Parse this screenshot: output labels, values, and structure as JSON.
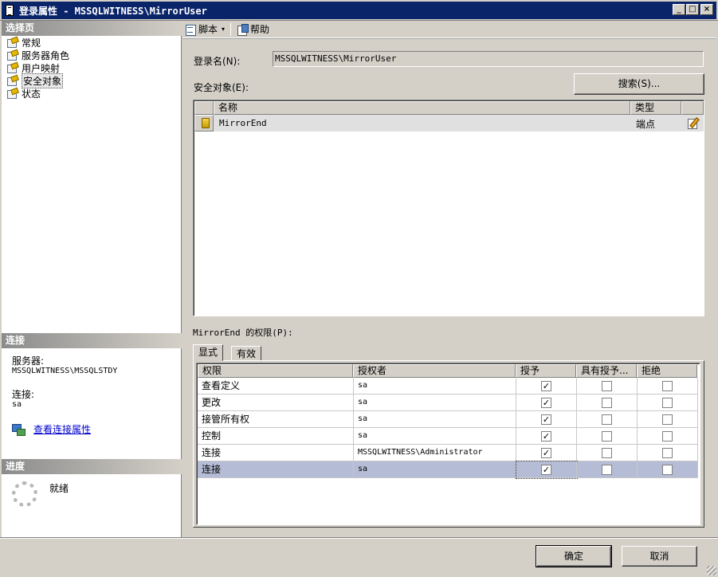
{
  "window": {
    "title": "登录属性 - MSSQLWITNESS\\MirrorUser",
    "minimize_glyph": "_",
    "maximize_glyph": "□",
    "close_glyph": "×"
  },
  "left_pane": {
    "select_page_header": "选择页",
    "pages": [
      {
        "label": "常规"
      },
      {
        "label": "服务器角色"
      },
      {
        "label": "用户映射"
      },
      {
        "label": "安全对象"
      },
      {
        "label": "状态"
      }
    ],
    "connection": {
      "header": "连接",
      "server_label": "服务器:",
      "server_value": "MSSQLWITNESS\\MSSQLSTDY",
      "connection_label": "连接:",
      "connection_value": "sa",
      "view_properties_link": "查看连接属性"
    },
    "progress": {
      "header": "进度",
      "status": "就绪"
    }
  },
  "toolbar": {
    "script_label": "脚本",
    "help_label": "帮助",
    "caret": "▾"
  },
  "form": {
    "login_name_label": "登录名(N):",
    "login_name_value": "MSSQLWITNESS\\MirrorUser",
    "securables_label": "安全对象(E):",
    "search_button": "搜索(S)...",
    "securables_table": {
      "headers": {
        "name": "名称",
        "type": "类型"
      },
      "rows": [
        {
          "name": "MirrorEnd",
          "type": "端点"
        }
      ]
    },
    "permissions_label": "MirrorEnd 的权限(P):",
    "tabs": {
      "explicit": "显式",
      "effective": "有效"
    },
    "permissions_table": {
      "headers": {
        "permission": "权限",
        "grantor": "授权者",
        "grant": "授予",
        "with_grant": "具有授予...",
        "deny": "拒绝"
      },
      "check_glyph": "✓",
      "rows": [
        {
          "permission": "查看定义",
          "grantor": "sa",
          "grant": true,
          "with_grant": false,
          "deny": false
        },
        {
          "permission": "更改",
          "grantor": "sa",
          "grant": true,
          "with_grant": false,
          "deny": false
        },
        {
          "permission": "接管所有权",
          "grantor": "sa",
          "grant": true,
          "with_grant": false,
          "deny": false
        },
        {
          "permission": "控制",
          "grantor": "sa",
          "grant": true,
          "with_grant": false,
          "deny": false
        },
        {
          "permission": "连接",
          "grantor": "MSSQLWITNESS\\Administrator",
          "grant": true,
          "with_grant": false,
          "deny": false
        },
        {
          "permission": "连接",
          "grantor": "sa",
          "grant": true,
          "with_grant": false,
          "deny": false
        }
      ]
    }
  },
  "footer": {
    "ok_button": "确定",
    "cancel_button": "取消"
  }
}
